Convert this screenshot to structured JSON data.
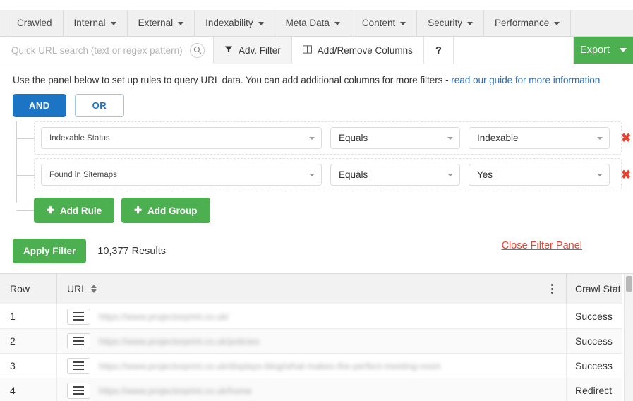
{
  "tabs": [
    {
      "label": "Crawled",
      "has_caret": false
    },
    {
      "label": "Internal",
      "has_caret": true
    },
    {
      "label": "External",
      "has_caret": true
    },
    {
      "label": "Indexability",
      "has_caret": true
    },
    {
      "label": "Meta Data",
      "has_caret": true
    },
    {
      "label": "Content",
      "has_caret": true
    },
    {
      "label": "Security",
      "has_caret": true
    },
    {
      "label": "Performance",
      "has_caret": true
    }
  ],
  "toolbar": {
    "search_placeholder": "Quick URL search (text or regex pattern)",
    "search_value": "",
    "search_icon": "search-icon",
    "adv_filter_label": "Adv. Filter",
    "adv_filter_icon": "funnel-icon",
    "add_remove_columns_label": "Add/Remove Columns",
    "add_remove_columns_icon": "columns-icon",
    "help_label": "?",
    "export_label": "Export",
    "export_color": "#4caf50"
  },
  "panel": {
    "description_text": "Use the panel below to set up rules to query URL data. You can add additional columns for more filters - ",
    "description_link": "read our guide for more information",
    "link_color": "#2a6fba",
    "and_label": "AND",
    "or_label": "OR",
    "active_operator": "AND",
    "rules": [
      {
        "field": "Indexable Status",
        "operator": "Equals",
        "value": "Indexable",
        "delete_icon": "close-x-icon"
      },
      {
        "field": "Found in Sitemaps",
        "operator": "Equals",
        "value": "Yes",
        "delete_icon": "close-x-icon"
      }
    ],
    "add_rule_label": "Add Rule",
    "add_group_label": "Add Group",
    "add_icon": "plus-icon",
    "apply_filter_label": "Apply Filter",
    "results_text": "10,377 Results",
    "close_panel_label": "Close Filter Panel",
    "close_panel_color": "#e8432f"
  },
  "table": {
    "headers": {
      "row": "Row",
      "url": "URL",
      "status": "Crawl Stat",
      "sort_icon": "sort-arrows-icon",
      "menu_icon": "kebab-menu-icon"
    },
    "rows": [
      {
        "row": "1",
        "url": "https://www.projectorprint.co.uk/",
        "status": "Success",
        "menu_icon": "hamburger-icon"
      },
      {
        "row": "2",
        "url": "https://www.projectorprint.co.uk/policies",
        "status": "Success",
        "menu_icon": "hamburger-icon"
      },
      {
        "row": "3",
        "url": "https://www.projectorprint.co.uk/displays-blog/what-makes-the-perfect-meeting-room",
        "status": "Success",
        "menu_icon": "hamburger-icon"
      },
      {
        "row": "4",
        "url": "https://www.projectorprint.co.uk/home",
        "status": "Redirect",
        "menu_icon": "hamburger-icon"
      }
    ]
  }
}
